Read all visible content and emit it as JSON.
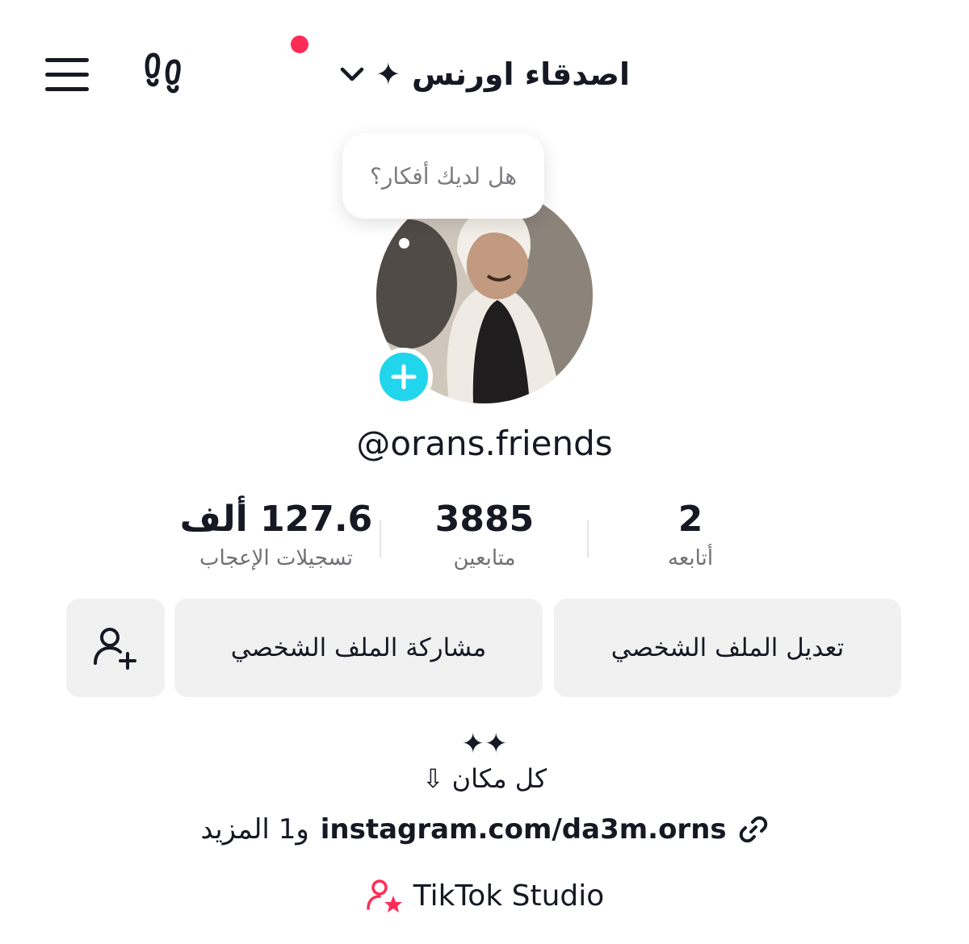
{
  "header": {
    "title": "اصدقاء اورنس ✦",
    "has_notification": true,
    "notification_color": "#fe2c55"
  },
  "profile": {
    "bubble_text": "هل لديك أفكار؟",
    "username": "@orans.friends",
    "add_color": "#20d5ec"
  },
  "stats": {
    "following": {
      "value": "2",
      "label": "أتابعه"
    },
    "followers": {
      "value": "3885",
      "label": "متابعين"
    },
    "likes": {
      "value": "127.6 ألف",
      "label": "تسجيلات الإعجاب"
    }
  },
  "actions": {
    "edit_profile": "تعديل الملف الشخصي",
    "share_profile": "مشاركة الملف الشخصي"
  },
  "bio": {
    "stars": "✦✦",
    "line2_text": "كل مكان",
    "line2_icon": "⇩",
    "link": "instagram.com/da3m.orns",
    "link_more": "و1 المزيد",
    "studio": "TikTok Studio",
    "studio_icon_color": "#fe2c55"
  }
}
